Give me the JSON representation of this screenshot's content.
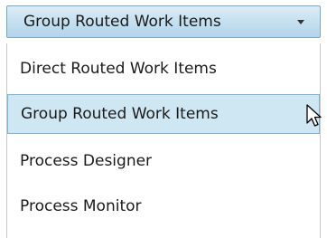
{
  "select": {
    "selected_value": "Group Routed Work Items",
    "caret_icon": "chevron-down-icon"
  },
  "dropdown": {
    "options": [
      {
        "label": "Direct Routed Work Items",
        "highlighted": false
      },
      {
        "label": "Group Routed Work Items",
        "highlighted": true
      },
      {
        "label": "Process Designer",
        "highlighted": false
      },
      {
        "label": "Process Monitor",
        "highlighted": false
      }
    ]
  },
  "cursor": {
    "icon": "mouse-pointer-icon"
  },
  "colors": {
    "select_border": "#7aa8c8",
    "highlight_bg": "#cfe7f3",
    "highlight_border": "#7fb3cf",
    "text": "#1a1a1a"
  }
}
